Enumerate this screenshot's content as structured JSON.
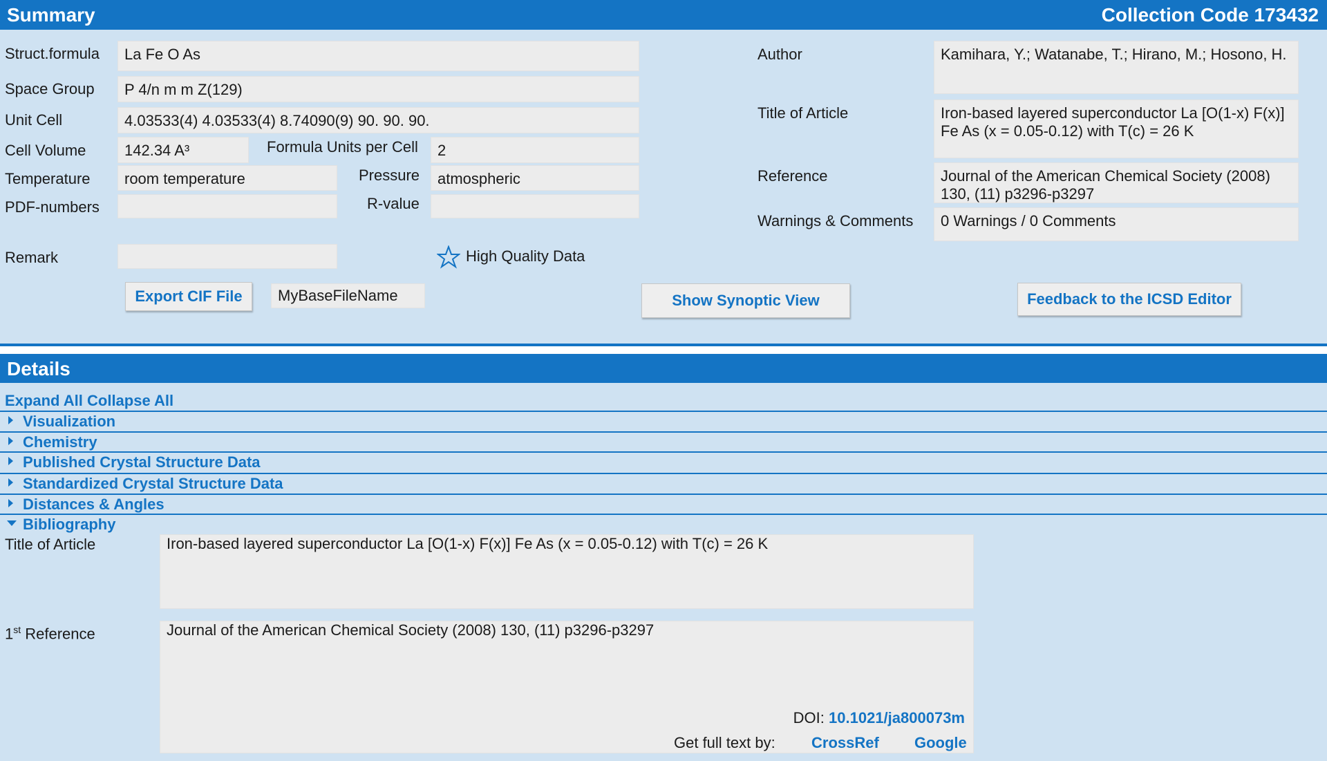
{
  "summary": {
    "title": "Summary",
    "collection_code": "Collection Code 173432",
    "labels": {
      "struct_formula": "Struct.formula",
      "space_group": "Space Group",
      "unit_cell": "Unit Cell",
      "cell_volume": "Cell Volume",
      "formula_units": "Formula Units per Cell",
      "temperature": "Temperature",
      "pressure": "Pressure",
      "pdf_numbers": "PDF-numbers",
      "r_value": "R-value",
      "remark": "Remark",
      "author": "Author",
      "title_of_article": "Title of Article",
      "reference": "Reference",
      "warnings_comments": "Warnings & Comments"
    },
    "values": {
      "struct_formula": "La Fe O As",
      "space_group": "P 4/n m m Z(129)",
      "unit_cell": "4.03533(4) 4.03533(4) 8.74090(9) 90. 90. 90.",
      "cell_volume": "142.34 A³",
      "formula_units": "2",
      "temperature": "room temperature",
      "pressure": "atmospheric",
      "pdf_numbers": "",
      "r_value": "",
      "remark": "",
      "author": "Kamihara, Y.; Watanabe, T.; Hirano, M.; Hosono, H.",
      "title_of_article": "Iron-based layered superconductor La [O(1-x) F(x)] Fe As (x = 0.05-0.12) with T(c) = 26 K",
      "reference": "Journal of the American Chemical Society (2008) 130, (11) p3296-p3297",
      "warnings_comments": "0 Warnings / 0 Comments"
    },
    "high_quality_label": "High Quality Data",
    "export_button": "Export CIF File",
    "base_filename": "MyBaseFileName",
    "synoptic_button": "Show Synoptic View",
    "feedback_button": "Feedback to the ICSD Editor"
  },
  "details": {
    "title": "Details",
    "expand_all": "Expand All",
    "collapse_all": "Collapse All",
    "sections": [
      "Visualization",
      "Chemistry",
      "Published Crystal Structure Data",
      "Standardized Crystal Structure Data",
      "Distances & Angles",
      "Bibliography"
    ],
    "bibliography": {
      "title_label": "Title of Article",
      "title_value": "Iron-based layered superconductor La [O(1-x) F(x)] Fe As (x = 0.05-0.12) with T(c) = 26 K",
      "ref_label_num": "1",
      "ref_label_sup": "st",
      "ref_label_text": " Reference",
      "ref_value": "Journal of the American Chemical Society (2008) 130, (11) p3296-p3297",
      "doi_label": "DOI:",
      "doi_value": "10.1021/ja800073m",
      "full_text_label": "Get full text by:",
      "crossref": "CrossRef",
      "google": "Google"
    }
  },
  "colors": {
    "header_blue": "#1474c4",
    "panel_bg": "#cfe2f2",
    "field_bg": "#ececec"
  }
}
